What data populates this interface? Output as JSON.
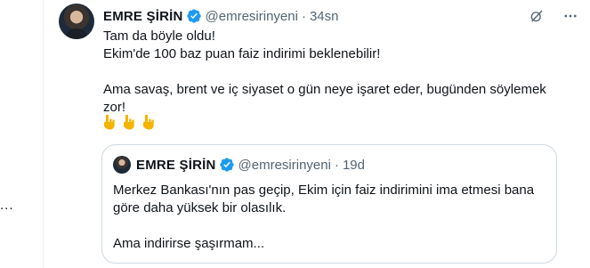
{
  "left_fragment": "...",
  "tweet": {
    "author_name": "EMRE ŞİRİN",
    "handle": "@emresirinyeni",
    "separator": "·",
    "time": "34sn",
    "lines": [
      "Tam da böyle oldu!",
      "Ekim'de 100 baz puan faiz indirimi beklenebilir!",
      "Ama savaş, brent ve iç siyaset o gün neye işaret eder, bugünden söylemek",
      "zor!"
    ],
    "emojis": [
      "👇",
      "👇",
      "👇"
    ],
    "icons": [
      "grok-icon",
      "more-options-icon"
    ]
  },
  "quote": {
    "author_name": "EMRE ŞİRİN",
    "handle": "@emresirinyeni",
    "separator": "·",
    "time": "19d",
    "lines": [
      "Merkez Bankası'nın pas geçip, Ekim için faiz indirimini ima etmesi bana",
      "göre daha yüksek bir olasılık.",
      "Ama indirirse şaşırmam..."
    ]
  },
  "colors": {
    "verified": "#1d9bf0",
    "secondary_text": "#536471",
    "border": "#cfd9de",
    "emoji": "#f4b400"
  }
}
